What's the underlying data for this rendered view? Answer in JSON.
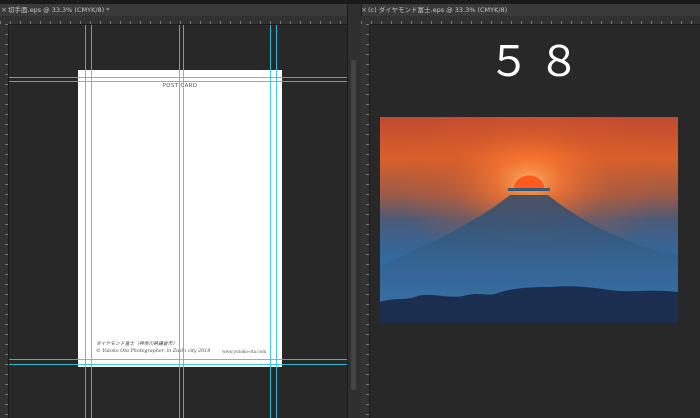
{
  "tabs": {
    "left_title": "切手面.eps @ 33.3% (CMYK/8) *",
    "right_title": "(c) ダイヤモンド富士.eps @ 33.3% (CMYK/8)",
    "close_glyph": "×"
  },
  "postcard": {
    "title": "POST CARD",
    "caption_line1": "ダイヤモンド富士（神奈川県鎌倉市）",
    "caption_line2": "© Yutoko Ota Photographer, in Zushi city 2018",
    "url": "www.yutoko-ota.com"
  },
  "right_doc": {
    "number_text": "５８"
  },
  "colors": {
    "app_bg": "#262626",
    "guide": "#33c8e0",
    "sky_top": "#d0502c",
    "sun": "#ff5a1e",
    "sea": "#2a6aa4"
  },
  "icons": {
    "close": "close-icon"
  }
}
